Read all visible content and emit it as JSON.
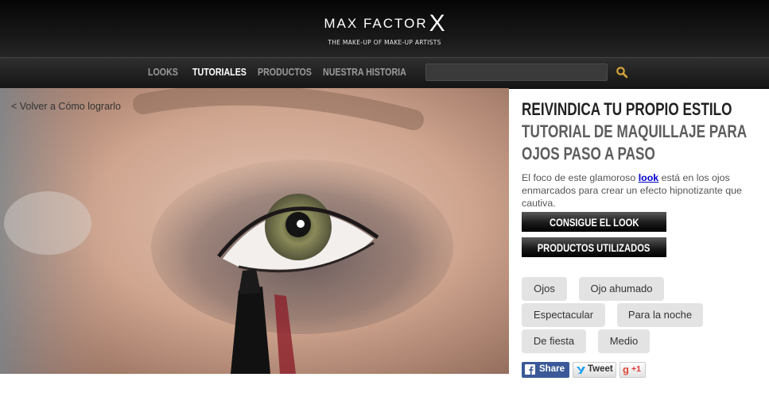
{
  "header": {
    "logo_text": "MAX FACTOR",
    "logo_x": "X",
    "tagline": "THE MAKE-UP OF MAKE-UP ARTISTS"
  },
  "nav": {
    "items": [
      {
        "label": "LOOKS",
        "active": false
      },
      {
        "label": "TUTORIALES",
        "active": true
      },
      {
        "label": "PRODUCTOS",
        "active": false
      },
      {
        "label": "NUESTRA HISTORIA",
        "active": false
      }
    ],
    "search_value": "",
    "search_icon": "search-icon"
  },
  "hero": {
    "back_link": "< Volver a Cómo lograrlo"
  },
  "article": {
    "title_line1": "REIVINDICA TU PROPIO ESTILO",
    "title_line2": "TUTORIAL DE MAQUILLAJE PARA",
    "title_line3": "OJOS PASO A PASO",
    "desc_before": "El foco de este glamoroso ",
    "desc_link": "look",
    "desc_after": " está en los ojos enmarcados para crear un efecto hipnotizante que cautiva.",
    "btn_get_look": "CONSIGUE EL LOOK",
    "btn_products": "PRODUCTOS UTILIZADOS"
  },
  "tags": [
    "Ojos",
    "Ojo ahumado",
    "Espectacular",
    "Para la noche",
    "De fiesta",
    "Medio"
  ],
  "social": {
    "facebook": "Share",
    "twitter": "Tweet",
    "google": "+1",
    "colors": {
      "facebook": "#3b5998",
      "google": "#dd4b39",
      "twitter": "#1da1f2"
    }
  }
}
